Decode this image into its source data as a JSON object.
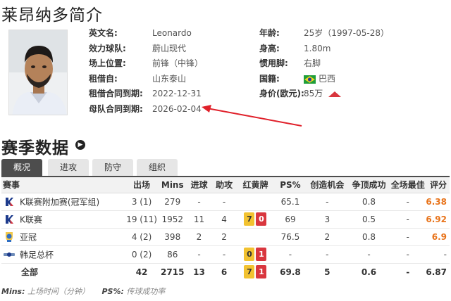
{
  "page_title": "莱昂纳多简介",
  "profile": {
    "english_name_label": "英文名:",
    "english_name": "Leonardo",
    "club_label": "效力球队:",
    "club": "蔚山现代",
    "position_label": "场上位置:",
    "position": "前锋（中锋）",
    "loan_from_label": "租借自:",
    "loan_from": "山东泰山",
    "loan_end_label": "租借合同到期:",
    "loan_end": "2022-12-31",
    "parent_contract_label": "母队合同到期:",
    "parent_contract": "2026-02-04",
    "age_label": "年龄:",
    "age": "25岁（1997-05-28）",
    "height_label": "身高:",
    "height": "1.80m",
    "foot_label": "惯用脚:",
    "foot": "右脚",
    "nationality_label": "国籍:",
    "nationality": "巴西",
    "value_label": "身价(欧元):",
    "value": "85万"
  },
  "season": {
    "title": "赛季数据",
    "tabs": [
      {
        "label": "概况",
        "active": true
      },
      {
        "label": "进攻",
        "active": false
      },
      {
        "label": "防守",
        "active": false
      },
      {
        "label": "组织",
        "active": false
      }
    ],
    "headers": [
      "赛事",
      "出场",
      "Mins",
      "进球",
      "助攻",
      "红黄牌",
      "PS%",
      "创造机会",
      "争顶成功",
      "全场最佳",
      "评分"
    ],
    "rows": [
      {
        "competition": "K联赛附加赛(冠军组)",
        "icon": "k-league-icon",
        "apps": "3 (1)",
        "mins": "279",
        "goals": "-",
        "assists": "-",
        "yellow": "",
        "red": "",
        "ps": "65.1",
        "chances": "-",
        "aerials": "0.8",
        "motm": "-",
        "rating": "6.38"
      },
      {
        "competition": "K联赛",
        "icon": "k-league-icon",
        "apps": "19 (11)",
        "mins": "1952",
        "goals": "11",
        "assists": "4",
        "yellow": "7",
        "red": "0",
        "ps": "69",
        "chances": "3",
        "aerials": "0.5",
        "motm": "-",
        "rating": "6.92"
      },
      {
        "competition": "亚冠",
        "icon": "afc-cl-icon",
        "apps": "4 (2)",
        "mins": "398",
        "goals": "2",
        "assists": "2",
        "yellow": "",
        "red": "",
        "ps": "76.5",
        "chances": "2",
        "aerials": "0.8",
        "motm": "-",
        "rating": "6.9"
      },
      {
        "competition": "韩足总杯",
        "icon": "fa-cup-icon",
        "apps": "0 (2)",
        "mins": "86",
        "goals": "-",
        "assists": "-",
        "yellow": "0",
        "red": "1",
        "ps": "-",
        "chances": "-",
        "aerials": "-",
        "motm": "-",
        "rating": "-"
      }
    ],
    "total": {
      "label": "全部",
      "apps": "42",
      "mins": "2715",
      "goals": "13",
      "assists": "6",
      "yellow": "7",
      "red": "1",
      "ps": "69.8",
      "chances": "5",
      "aerials": "0.6",
      "motm": "-",
      "rating": "6.87"
    },
    "footnote_mins_key": "Mins:",
    "footnote_mins": "上场时间（分钟）",
    "footnote_ps_key": "PS%:",
    "footnote_ps": "传球成功率"
  },
  "colors": {
    "rating": "#e8731a",
    "yellow_card": "#f2c230",
    "red_card": "#d9363e",
    "active_tab": "#4d4d4d",
    "annotation_arrow": "#e0202a"
  }
}
